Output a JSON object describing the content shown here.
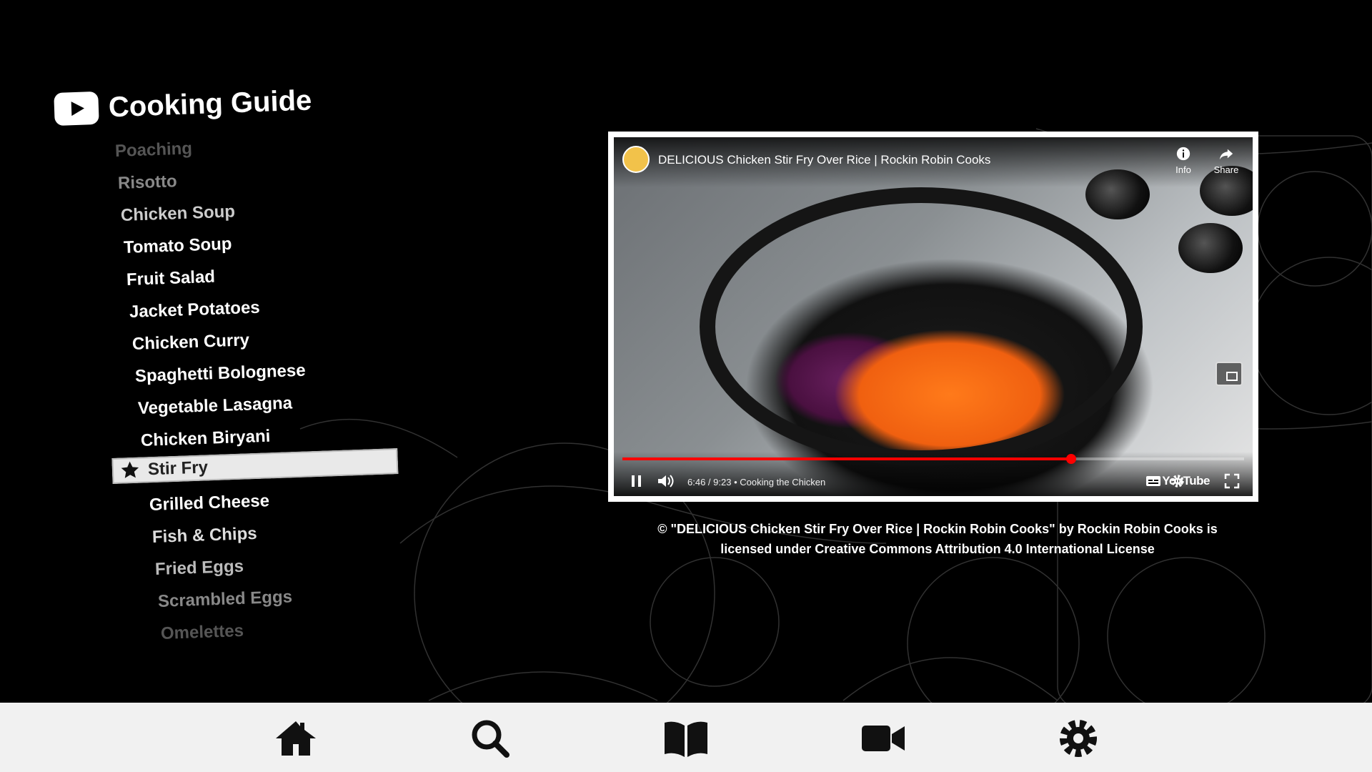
{
  "app": {
    "title": "Cooking Guide",
    "logo_icon": "youtube-play-icon"
  },
  "recipes": [
    {
      "label": "Poaching"
    },
    {
      "label": "Risotto"
    },
    {
      "label": "Chicken Soup"
    },
    {
      "label": "Tomato Soup"
    },
    {
      "label": "Fruit Salad"
    },
    {
      "label": "Jacket Potatoes"
    },
    {
      "label": "Chicken Curry"
    },
    {
      "label": "Spaghetti Bolognese"
    },
    {
      "label": "Vegetable Lasagna"
    },
    {
      "label": "Chicken Biryani"
    },
    {
      "label": "Stir Fry",
      "selected": true,
      "icon": "star-icon"
    },
    {
      "label": "Grilled Cheese"
    },
    {
      "label": "Fish & Chips"
    },
    {
      "label": "Fried Eggs"
    },
    {
      "label": "Scrambled Eggs"
    },
    {
      "label": "Omelettes"
    }
  ],
  "video": {
    "title": "DELICIOUS Chicken Stir Fry Over Rice | Rockin Robin Cooks",
    "info_label": "Info",
    "share_label": "Share",
    "time": "6:46 / 9:23",
    "separator": "•",
    "chapter": "Cooking the Chicken",
    "progress": 0.7224,
    "brand": "YouTube",
    "progress_color": "#ff0000"
  },
  "license": {
    "line1": "© \"DELICIOUS Chicken Stir Fry Over Rice | Rockin Robin Cooks\" by Rockin Robin Cooks is",
    "line2": "licensed under Creative Commons Attribution 4.0 International License"
  },
  "nav": [
    {
      "icon": "home-icon"
    },
    {
      "icon": "search-icon"
    },
    {
      "icon": "book-icon"
    },
    {
      "icon": "video-camera-icon"
    },
    {
      "icon": "gear-icon"
    }
  ]
}
